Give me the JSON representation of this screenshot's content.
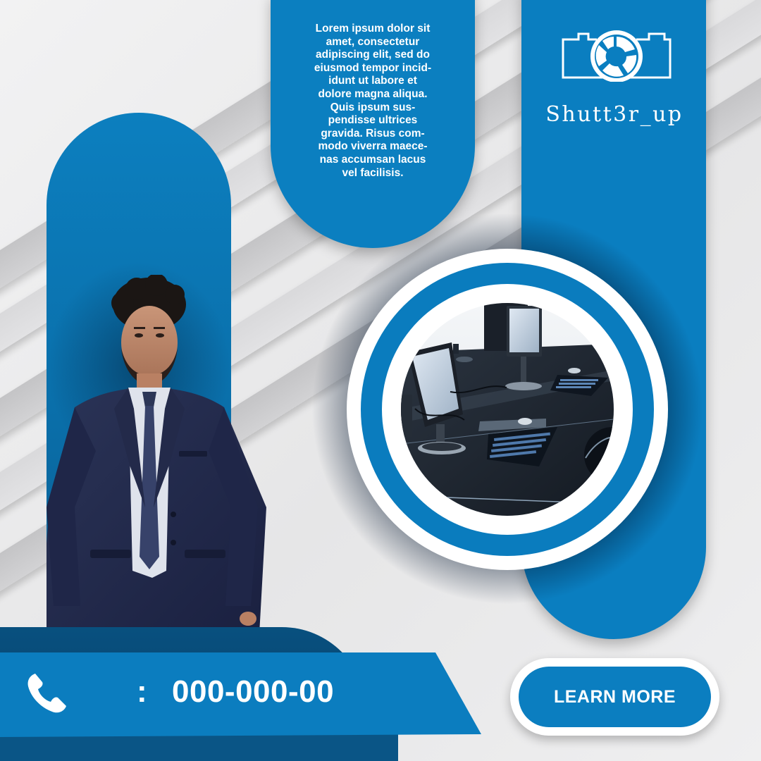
{
  "body_text": "Lorem ipsum dolor sit\namet, consectetur\nadipiscing elit, sed do\neiusmod tempor incid-\nidunt ut labore et\ndolore magna aliqua.\nQuis ipsum sus-\npendisse ultrices\ngravida. Risus com-\nmodo viverra maece-\nnas accumsan lacus\nvel facilisis.",
  "brand": {
    "name": "Shutt3r_up",
    "logo_icon": "camera-aperture-icon"
  },
  "contact": {
    "phone_icon": "phone-icon",
    "separator": ":",
    "phone_number": "000-000-00"
  },
  "cta": {
    "label": "LEARN MORE"
  },
  "images": {
    "person": "man-in-navy-suit-photo",
    "computer_lab": "computer-lab-photo"
  },
  "colors": {
    "primary_blue": "#0b7ec0",
    "dark_blue": "#073f66",
    "background_gray": "#e9e9ea",
    "stripe_gray": "#c4c4c6",
    "text_white": "#ffffff"
  }
}
